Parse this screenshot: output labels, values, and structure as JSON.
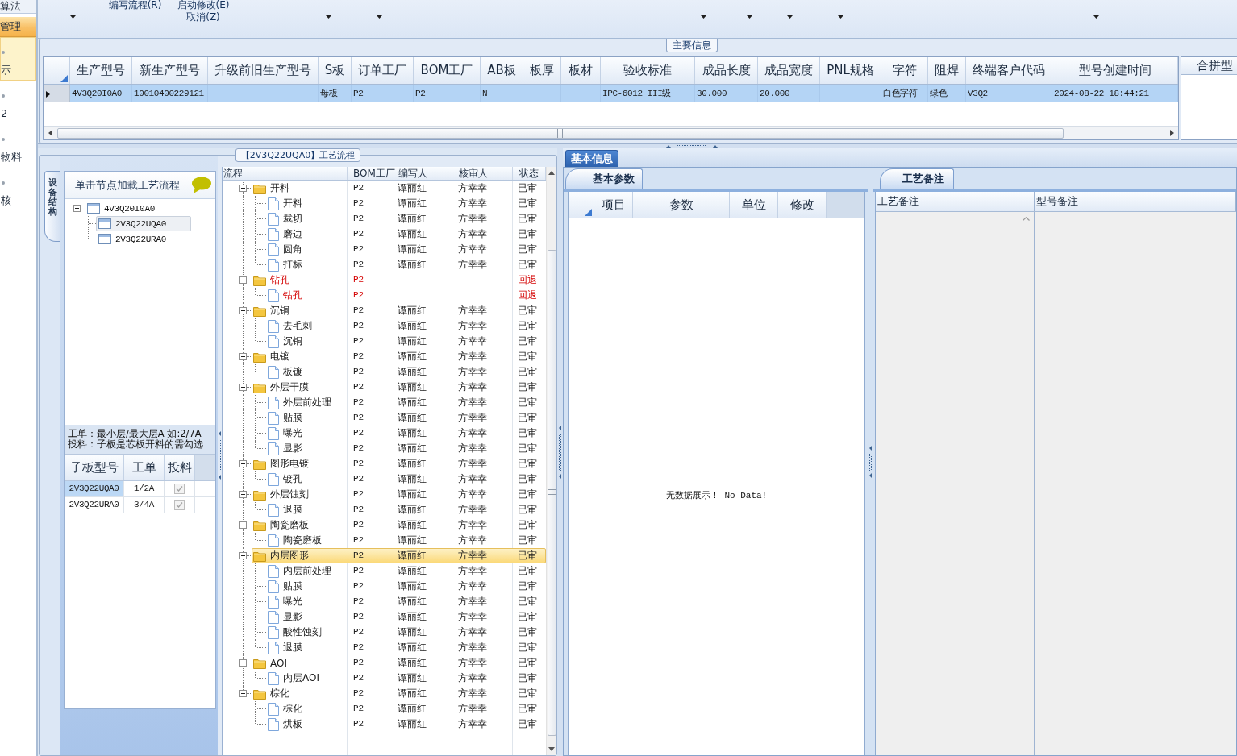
{
  "sidebar": {
    "items": [
      {
        "kind": "bar",
        "label": "算法",
        "selected": false,
        "highlighted": false
      },
      {
        "kind": "bar",
        "label": "管理",
        "selected": true,
        "highlighted": false
      },
      {
        "kind": "icon",
        "label": "示",
        "selected": false,
        "highlighted": true
      },
      {
        "kind": "icon",
        "label": "2",
        "selected": false,
        "highlighted": false
      },
      {
        "kind": "icon",
        "label": "物料",
        "selected": false,
        "highlighted": false
      },
      {
        "kind": "icon",
        "label": "核",
        "selected": false,
        "highlighted": false
      }
    ]
  },
  "toolbar": {
    "buttons": [
      {
        "label": "编写流程(R)"
      },
      {
        "label": "启动修改(E) 取消(Z)"
      }
    ]
  },
  "main_info": {
    "title": "主要信息",
    "columns": [
      "生产型号",
      "新生产型号",
      "升级前旧生产型号",
      "S板",
      "订单工厂",
      "BOM工厂",
      "AB板",
      "板厚",
      "板材",
      "验收标准",
      "成品长度",
      "成品宽度",
      "PNL规格",
      "字符",
      "阻焊",
      "终端客户代码",
      "型号创建时间"
    ],
    "rows": [
      {
        "selected": true,
        "cells": [
          "4V3Q20I0A0",
          "10010400229121",
          null,
          "母板",
          "P2",
          "P2",
          "N",
          null,
          null,
          "IPC-6012 III级",
          "30.000",
          "20.000",
          null,
          "白色字符",
          "绿色",
          "V3Q2",
          "2024-08-22 18:44:21"
        ]
      }
    ],
    "side_column": "合拼型"
  },
  "process_group": {
    "title": "【2V3Q22UQA0】工艺流程",
    "structure": {
      "tab": {
        "label": "设备结构",
        "selected": true
      },
      "hint": "单击节点加载工艺流程",
      "tree": [
        {
          "label": "4V3Q20I0A0",
          "expanded": true,
          "selected": false,
          "children": [
            {
              "label": "2V3Q22UQA0",
              "selected": true
            },
            {
              "label": "2V3Q22URA0",
              "selected": false
            }
          ]
        }
      ],
      "notes": [
        "工单：最小层/最大层A 如:2/7A",
        "投料：子板是芯板开料的需勾选"
      ],
      "sub_boards": {
        "columns": [
          "子板型号",
          "工单",
          "投料"
        ],
        "rows": [
          {
            "model": "2V3Q22UQA0",
            "order": "1/2A",
            "checked": true,
            "disabled": true,
            "selected": true
          },
          {
            "model": "2V3Q22URA0",
            "order": "3/4A",
            "checked": true,
            "disabled": true,
            "selected": false
          }
        ]
      }
    },
    "flow": {
      "columns": [
        "流程",
        "BOM工厂",
        "编写人",
        "核审人",
        "状态"
      ],
      "nodes": [
        {
          "name": "开料",
          "bom_factory": "P2",
          "writer": "谭丽红",
          "reviewer": "方幸幸",
          "status": "已审",
          "returned": false,
          "selected": false,
          "expanded": true,
          "children": [
            {
              "name": "开料",
              "bom_factory": "P2",
              "writer": "谭丽红",
              "reviewer": "方幸幸",
              "status": "已审",
              "returned": false,
              "selected": false
            },
            {
              "name": "裁切",
              "bom_factory": "P2",
              "writer": "谭丽红",
              "reviewer": "方幸幸",
              "status": "已审",
              "returned": false,
              "selected": false
            },
            {
              "name": "磨边",
              "bom_factory": "P2",
              "writer": "谭丽红",
              "reviewer": "方幸幸",
              "status": "已审",
              "returned": false,
              "selected": false
            },
            {
              "name": "圆角",
              "bom_factory": "P2",
              "writer": "谭丽红",
              "reviewer": "方幸幸",
              "status": "已审",
              "returned": false,
              "selected": false
            },
            {
              "name": "打标",
              "bom_factory": "P2",
              "writer": "谭丽红",
              "reviewer": "方幸幸",
              "status": "已审",
              "returned": false,
              "selected": false
            }
          ]
        },
        {
          "name": "钻孔",
          "bom_factory": "P2",
          "status": "回退",
          "returned": true,
          "selected": false,
          "expanded": true,
          "children": [
            {
              "name": "钻孔",
              "bom_factory": "P2",
              "status": "回退",
              "returned": true,
              "selected": false
            }
          ]
        },
        {
          "name": "沉铜",
          "bom_factory": "P2",
          "writer": "谭丽红",
          "reviewer": "方幸幸",
          "status": "已审",
          "returned": false,
          "selected": false,
          "expanded": true,
          "children": [
            {
              "name": "去毛刺",
              "bom_factory": "P2",
              "writer": "谭丽红",
              "reviewer": "方幸幸",
              "status": "已审",
              "returned": false,
              "selected": false
            },
            {
              "name": "沉铜",
              "bom_factory": "P2",
              "writer": "谭丽红",
              "reviewer": "方幸幸",
              "status": "已审",
              "returned": false,
              "selected": false
            }
          ]
        },
        {
          "name": "电镀",
          "bom_factory": "P2",
          "writer": "谭丽红",
          "reviewer": "方幸幸",
          "status": "已审",
          "returned": false,
          "selected": false,
          "expanded": true,
          "children": [
            {
              "name": "板镀",
              "bom_factory": "P2",
              "writer": "谭丽红",
              "reviewer": "方幸幸",
              "status": "已审",
              "returned": false,
              "selected": false
            }
          ]
        },
        {
          "name": "外层干膜",
          "bom_factory": "P2",
          "writer": "谭丽红",
          "reviewer": "方幸幸",
          "status": "已审",
          "returned": false,
          "selected": false,
          "expanded": true,
          "children": [
            {
              "name": "外层前处理",
              "bom_factory": "P2",
              "writer": "谭丽红",
              "reviewer": "方幸幸",
              "status": "已审",
              "returned": false,
              "selected": false
            },
            {
              "name": "贴膜",
              "bom_factory": "P2",
              "writer": "谭丽红",
              "reviewer": "方幸幸",
              "status": "已审",
              "returned": false,
              "selected": false
            },
            {
              "name": "曝光",
              "bom_factory": "P2",
              "writer": "谭丽红",
              "reviewer": "方幸幸",
              "status": "已审",
              "returned": false,
              "selected": false
            },
            {
              "name": "显影",
              "bom_factory": "P2",
              "writer": "谭丽红",
              "reviewer": "方幸幸",
              "status": "已审",
              "returned": false,
              "selected": false
            }
          ]
        },
        {
          "name": "图形电镀",
          "bom_factory": "P2",
          "writer": "谭丽红",
          "reviewer": "方幸幸",
          "status": "已审",
          "returned": false,
          "selected": false,
          "expanded": true,
          "children": [
            {
              "name": "镀孔",
              "bom_factory": "P2",
              "writer": "谭丽红",
              "reviewer": "方幸幸",
              "status": "已审",
              "returned": false,
              "selected": false
            }
          ]
        },
        {
          "name": "外层蚀刻",
          "bom_factory": "P2",
          "writer": "谭丽红",
          "reviewer": "方幸幸",
          "status": "已审",
          "returned": false,
          "selected": false,
          "expanded": true,
          "children": [
            {
              "name": "退膜",
              "bom_factory": "P2",
              "writer": "谭丽红",
              "reviewer": "方幸幸",
              "status": "已审",
              "returned": false,
              "selected": false
            }
          ]
        },
        {
          "name": "陶瓷磨板",
          "bom_factory": "P2",
          "writer": "谭丽红",
          "reviewer": "方幸幸",
          "status": "已审",
          "returned": false,
          "selected": false,
          "expanded": true,
          "children": [
            {
              "name": "陶瓷磨板",
              "bom_factory": "P2",
              "writer": "谭丽红",
              "reviewer": "方幸幸",
              "status": "已审",
              "returned": false,
              "selected": false
            }
          ]
        },
        {
          "name": "内层图形",
          "bom_factory": "P2",
          "writer": "谭丽红",
          "reviewer": "方幸幸",
          "status": "已审",
          "returned": false,
          "selected": true,
          "expanded": true,
          "children": [
            {
              "name": "内层前处理",
              "bom_factory": "P2",
              "writer": "谭丽红",
              "reviewer": "方幸幸",
              "status": "已审",
              "returned": false,
              "selected": false
            },
            {
              "name": "贴膜",
              "bom_factory": "P2",
              "writer": "谭丽红",
              "reviewer": "方幸幸",
              "status": "已审",
              "returned": false,
              "selected": false
            },
            {
              "name": "曝光",
              "bom_factory": "P2",
              "writer": "谭丽红",
              "reviewer": "方幸幸",
              "status": "已审",
              "returned": false,
              "selected": false
            },
            {
              "name": "显影",
              "bom_factory": "P2",
              "writer": "谭丽红",
              "reviewer": "方幸幸",
              "status": "已审",
              "returned": false,
              "selected": false
            },
            {
              "name": "酸性蚀刻",
              "bom_factory": "P2",
              "writer": "谭丽红",
              "reviewer": "方幸幸",
              "status": "已审",
              "returned": false,
              "selected": false
            },
            {
              "name": "退膜",
              "bom_factory": "P2",
              "writer": "谭丽红",
              "reviewer": "方幸幸",
              "status": "已审",
              "returned": false,
              "selected": false
            }
          ]
        },
        {
          "name": "AOI",
          "bom_factory": "P2",
          "writer": "谭丽红",
          "reviewer": "方幸幸",
          "status": "已审",
          "returned": false,
          "selected": false,
          "expanded": true,
          "children": [
            {
              "name": "内层AOI",
              "bom_factory": "P2",
              "writer": "谭丽红",
              "reviewer": "方幸幸",
              "status": "已审",
              "returned": false,
              "selected": false
            }
          ]
        },
        {
          "name": "棕化",
          "bom_factory": "P2",
          "writer": "谭丽红",
          "reviewer": "方幸幸",
          "status": "已审",
          "returned": false,
          "selected": false,
          "expanded": true,
          "children": [
            {
              "name": "棕化",
              "bom_factory": "P2",
              "writer": "谭丽红",
              "reviewer": "方幸幸",
              "status": "已审",
              "returned": false,
              "selected": false
            },
            {
              "name": "烘板",
              "bom_factory": "P2",
              "writer": "谭丽红",
              "reviewer": "方幸幸",
              "status": "已审",
              "returned": false,
              "selected": false
            }
          ]
        }
      ]
    }
  },
  "detail": {
    "tabs": [
      {
        "label": "基本信息",
        "selected": true
      }
    ],
    "params": {
      "tab": {
        "label": "基本参数",
        "selected": true
      },
      "columns": [
        "项目",
        "参数",
        "单位",
        "修改"
      ],
      "empty_text": "无数据展示！ No Data!"
    },
    "remarks": {
      "tab": {
        "label": "工艺备注",
        "selected": true
      },
      "columns": [
        "工艺备注",
        "型号备注"
      ]
    }
  }
}
